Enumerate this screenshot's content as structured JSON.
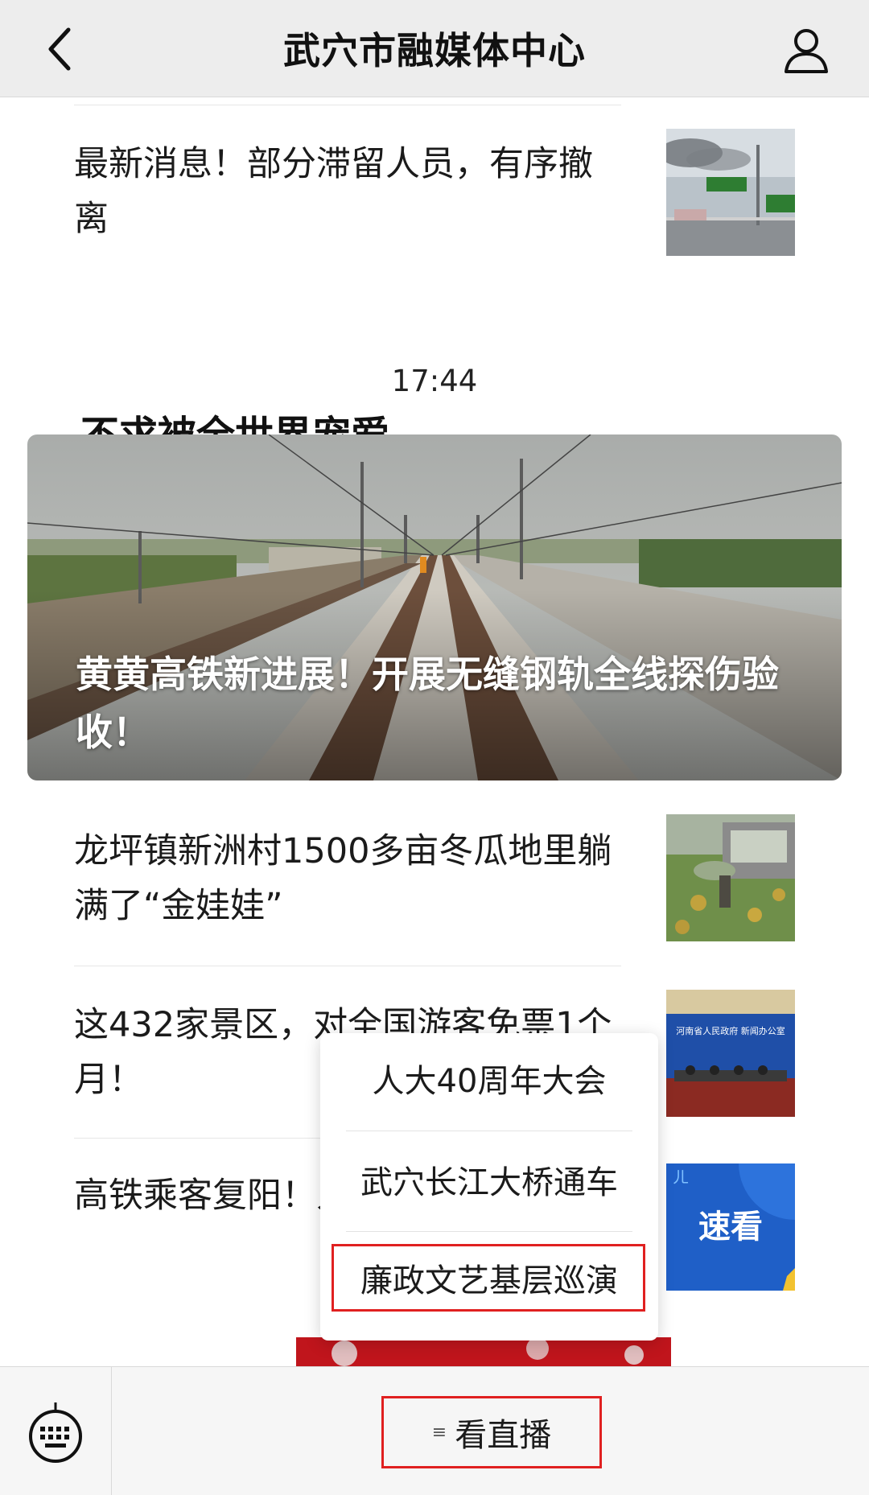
{
  "header": {
    "title": "武穴市融媒体中心"
  },
  "articles": [
    {
      "title": "最新消息！部分滞留人员，有序撤离"
    },
    {
      "title": "龙坪镇新洲村1500多亩冬瓜地里躺满了“金娃娃”"
    },
    {
      "title": "这432家景区，对全国游客免票1个月！"
    },
    {
      "title": "高铁乘客复阳！人"
    }
  ],
  "timestamp": "17:44",
  "partial_headline": "不求被全世界宠爱",
  "featured": {
    "title": "黄黄高铁新进展！开展无缝钢轨全线探伤验收！"
  },
  "thumbnails": {
    "speed_text": "速看",
    "press_text": "河南省人民政府 新闻办公室"
  },
  "popup_menu": {
    "items": [
      "人大40周年大会",
      "武穴长江大桥通车",
      "廉政文艺基层巡演"
    ]
  },
  "bottom_bar": {
    "live_label": "看直播",
    "menu_mark": "≡"
  },
  "colors": {
    "header_bg": "#ededed",
    "highlight_red": "#e02020",
    "thumb_blue": "#1f5fc7"
  },
  "icons": [
    "back-arrow-icon",
    "user-icon",
    "keyboard-icon",
    "menu-lines-icon"
  ]
}
